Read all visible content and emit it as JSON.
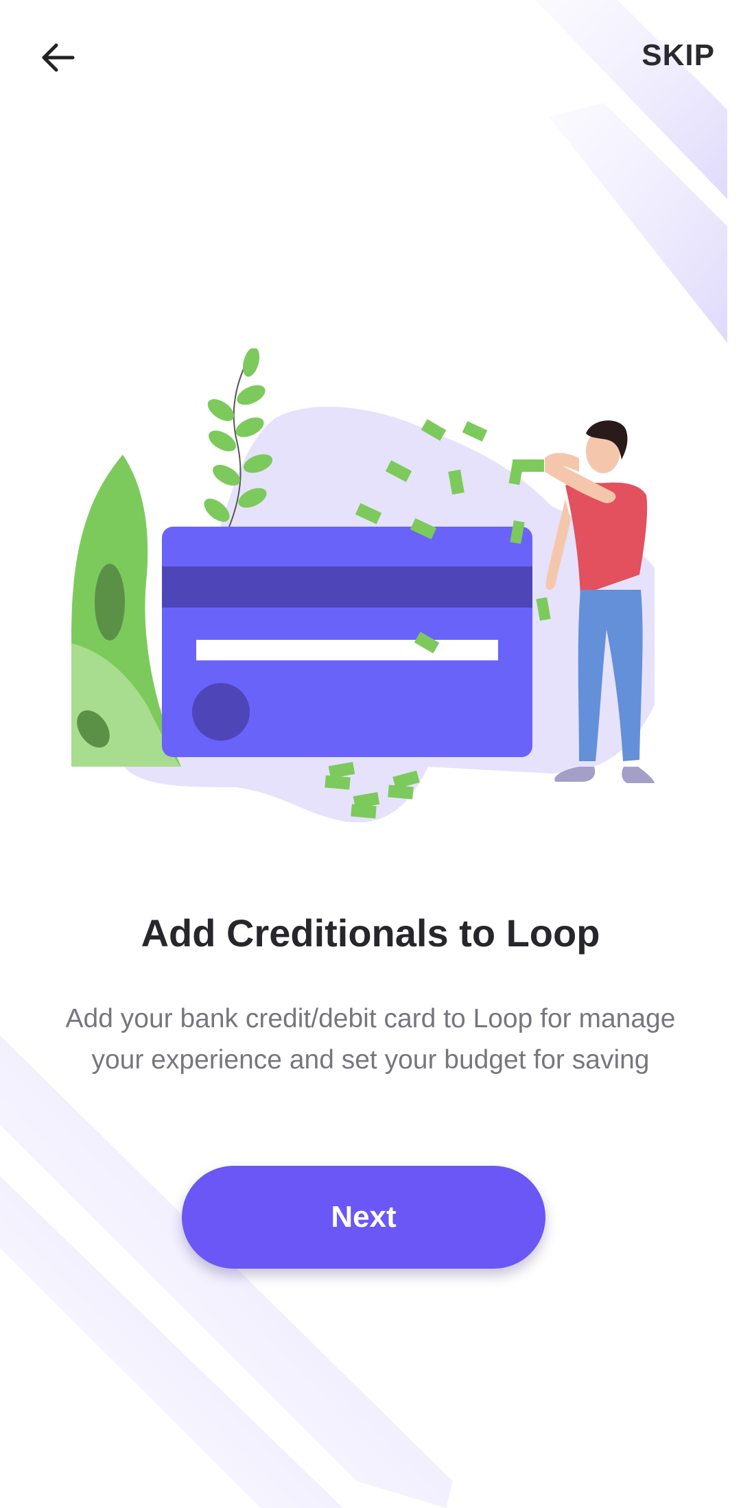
{
  "header": {
    "back_icon": "arrow-left-icon",
    "skip_label": "SKIP"
  },
  "onboarding": {
    "illustration": "credit-card-with-man-and-money-illustration",
    "title": "Add Creditionals to Loop",
    "description": "Add your bank credit/debit card to Loop for manage your experience and set your budget for saving",
    "next_label": "Next"
  },
  "colors": {
    "accent": "#6a57f5",
    "decor_stripe": "#e6e2fb",
    "card": "#6a63fa",
    "card_stripe": "#4e46b8",
    "leaf": "#7cca5c",
    "shirt": "#e3505e",
    "jeans": "#6390d8"
  }
}
